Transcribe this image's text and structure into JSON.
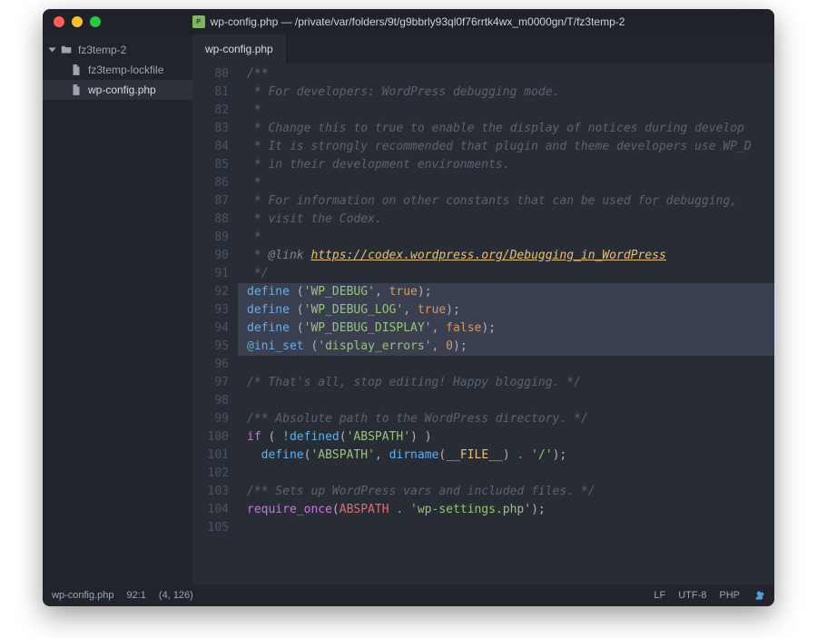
{
  "title": "wp-config.php — /private/var/folders/9t/g9bbrly93ql0f76rrtk4wx_m0000gn/T/fz3temp-2",
  "traffic": {
    "close": "#ff5f57",
    "min": "#febc2e",
    "max": "#28c840"
  },
  "sidebar": {
    "root": "fz3temp-2",
    "items": [
      {
        "label": "fz3temp-lockfile",
        "selected": false
      },
      {
        "label": "wp-config.php",
        "selected": true
      }
    ]
  },
  "tab": {
    "label": "wp-config.php"
  },
  "code": {
    "first_line": 80,
    "highlights": [
      92,
      93,
      94,
      95
    ],
    "lines": [
      [
        [
          "c-comment",
          "/**"
        ]
      ],
      [
        [
          "c-comment",
          " * For developers: WordPress debugging mode."
        ]
      ],
      [
        [
          "c-comment",
          " *"
        ]
      ],
      [
        [
          "c-comment",
          " * Change this to true to enable the display of notices during develop"
        ]
      ],
      [
        [
          "c-comment",
          " * It is strongly recommended that plugin and theme developers use WP_D"
        ]
      ],
      [
        [
          "c-comment",
          " * in their development environments."
        ]
      ],
      [
        [
          "c-comment",
          " *"
        ]
      ],
      [
        [
          "c-comment",
          " * For information on other constants that can be used for debugging,"
        ]
      ],
      [
        [
          "c-comment",
          " * visit the Codex."
        ]
      ],
      [
        [
          "c-comment",
          " *"
        ]
      ],
      [
        [
          "c-comment",
          " * "
        ],
        [
          "c-tag",
          "@link"
        ],
        [
          "c-comment",
          " "
        ],
        [
          "c-var",
          "https://codex.wordpress.org/Debugging_in_WordPress"
        ]
      ],
      [
        [
          "c-comment",
          " */"
        ]
      ],
      [
        [
          "c-func",
          "define"
        ],
        [
          "c-punct",
          " ("
        ],
        [
          "c-string",
          "'WP_DEBUG'"
        ],
        [
          "c-punct",
          ", "
        ],
        [
          "c-bool",
          "true"
        ],
        [
          "c-punct",
          ");"
        ]
      ],
      [
        [
          "c-func",
          "define"
        ],
        [
          "c-punct",
          " ("
        ],
        [
          "c-string",
          "'WP_DEBUG_LOG'"
        ],
        [
          "c-punct",
          ", "
        ],
        [
          "c-bool",
          "true"
        ],
        [
          "c-punct",
          ");"
        ]
      ],
      [
        [
          "c-func",
          "define"
        ],
        [
          "c-punct",
          " ("
        ],
        [
          "c-string",
          "'WP_DEBUG_DISPLAY'"
        ],
        [
          "c-punct",
          ", "
        ],
        [
          "c-bool",
          "false"
        ],
        [
          "c-punct",
          ");"
        ]
      ],
      [
        [
          "c-op",
          "@"
        ],
        [
          "c-func",
          "ini_set"
        ],
        [
          "c-punct",
          " ("
        ],
        [
          "c-string",
          "'display_errors'"
        ],
        [
          "c-punct",
          ", "
        ],
        [
          "c-num",
          "0"
        ],
        [
          "c-punct",
          ");"
        ]
      ],
      [],
      [
        [
          "c-comment",
          "/* That's all, stop editing! Happy blogging. */"
        ]
      ],
      [],
      [
        [
          "c-comment",
          "/** Absolute path to the WordPress directory. */"
        ]
      ],
      [
        [
          "c-keyword",
          "if"
        ],
        [
          "c-punct",
          " ( "
        ],
        [
          "c-op",
          "!"
        ],
        [
          "c-func",
          "defined"
        ],
        [
          "c-punct",
          "("
        ],
        [
          "c-string",
          "'ABSPATH'"
        ],
        [
          "c-punct",
          ") )"
        ]
      ],
      [
        [
          "c-punct",
          "  "
        ],
        [
          "c-func",
          "define"
        ],
        [
          "c-punct",
          "("
        ],
        [
          "c-string",
          "'ABSPATH'"
        ],
        [
          "c-punct",
          ", "
        ],
        [
          "c-func",
          "dirname"
        ],
        [
          "c-punct",
          "("
        ],
        [
          "c-builtin",
          "__FILE__"
        ],
        [
          "c-punct",
          ") "
        ],
        [
          "c-op",
          "."
        ],
        [
          "c-punct",
          " "
        ],
        [
          "c-string",
          "'/'"
        ],
        [
          "c-punct",
          ");"
        ]
      ],
      [],
      [
        [
          "c-comment",
          "/** Sets up WordPress vars and included files. */"
        ]
      ],
      [
        [
          "c-keyword",
          "require_once"
        ],
        [
          "c-punct",
          "("
        ],
        [
          "c-const",
          "ABSPATH"
        ],
        [
          "c-punct",
          " "
        ],
        [
          "c-op",
          "."
        ],
        [
          "c-punct",
          " "
        ],
        [
          "c-string",
          "'wp-settings.php'"
        ],
        [
          "c-punct",
          ");"
        ]
      ],
      []
    ]
  },
  "statusbar": {
    "file": "wp-config.php",
    "cursor": "92:1",
    "selection": "(4, 126)",
    "eol": "LF",
    "encoding": "UTF-8",
    "lang": "PHP"
  }
}
